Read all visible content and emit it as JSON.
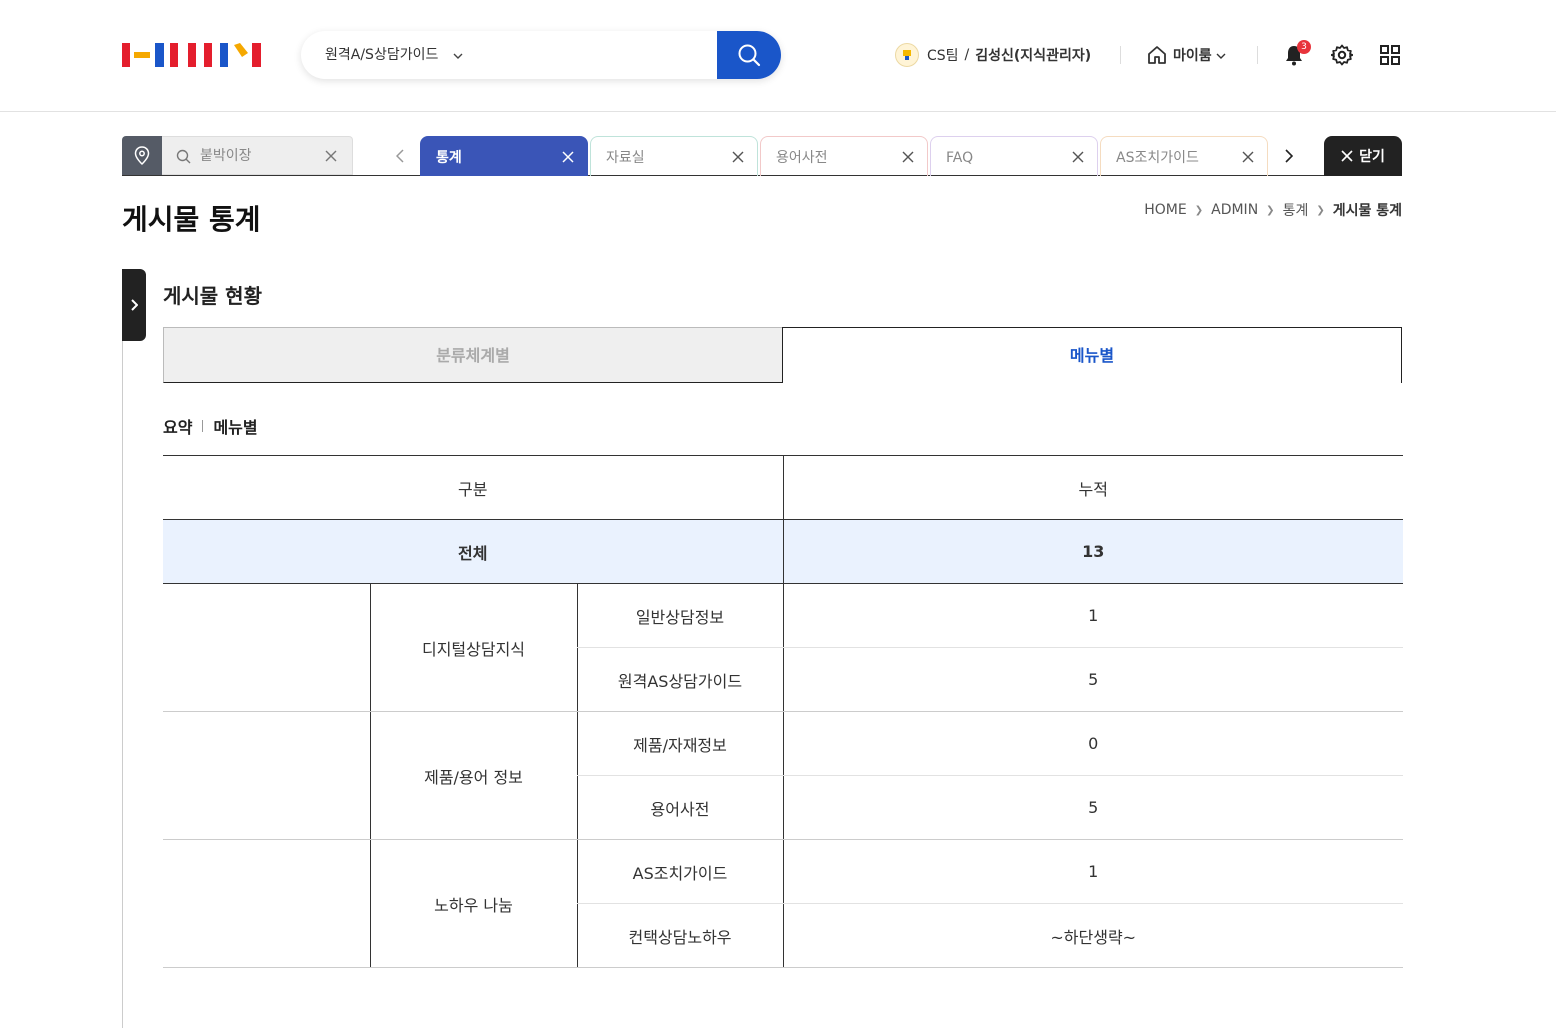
{
  "header": {
    "search_scope": "원격A/S상담가이드",
    "user_team": "CS팀",
    "user_name": "김성신(지식관리자)",
    "myroom_label": "마이룸",
    "notification_count": "3",
    "accent_color": "#1a56c9"
  },
  "tabs": {
    "pinned_label": "붙박이장",
    "items": [
      {
        "label": "통계",
        "active": true
      },
      {
        "label": "자료실"
      },
      {
        "label": "용어사전"
      },
      {
        "label": "FAQ"
      },
      {
        "label": "AS조치가이드"
      }
    ],
    "close_all_label": "닫기"
  },
  "page": {
    "title": "게시물 통계",
    "breadcrumb": [
      "HOME",
      "ADMIN",
      "통계",
      "게시물 통계"
    ]
  },
  "section": {
    "title": "게시물 현황",
    "seg_tabs": [
      "분류체계별",
      "메뉴별"
    ],
    "sub_nav": [
      "요약",
      "메뉴별"
    ]
  },
  "table": {
    "headers": [
      "구분",
      "누적"
    ],
    "total_label": "전체",
    "total_value": "13",
    "groups": [
      {
        "name": "디지털상담지식",
        "rows": [
          {
            "label": "일반상담정보",
            "value": "1"
          },
          {
            "label": "원격AS상담가이드",
            "value": "5"
          }
        ]
      },
      {
        "name": "제품/용어 정보",
        "rows": [
          {
            "label": "제품/자재정보",
            "value": "0"
          },
          {
            "label": "용어사전",
            "value": "5"
          }
        ]
      },
      {
        "name": "노하우 나눔",
        "rows": [
          {
            "label": "AS조치가이드",
            "value": "1"
          },
          {
            "label": "컨택상담노하우",
            "value": "~하단생략~"
          }
        ]
      }
    ]
  }
}
